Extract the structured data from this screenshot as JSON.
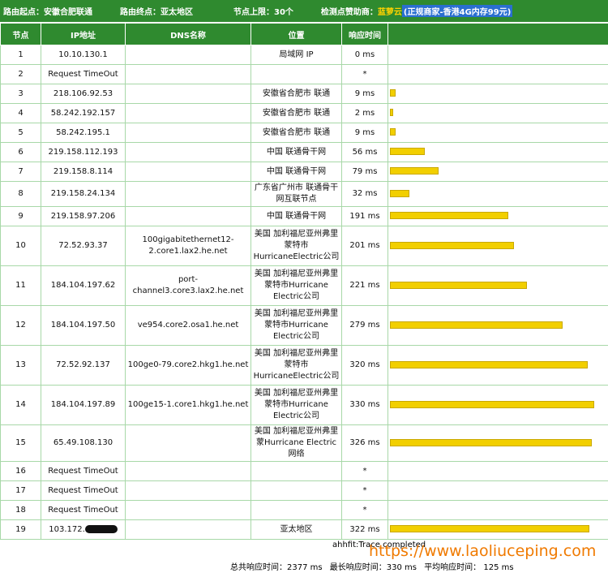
{
  "header": {
    "route_start": "路由起点：安徽合肥联通",
    "route_end": "路由终点：亚太地区",
    "node_limit": "节点上限：30个",
    "sponsor_label": "检测点赞助商：",
    "sponsor_name": "蓝萝云",
    "sponsor_note": "(正规商家-香港4G内存99元)"
  },
  "columns": [
    "节点",
    "IP地址",
    "DNS名称",
    "位置",
    "响应时间",
    ""
  ],
  "rows": [
    {
      "node": "1",
      "ip": "10.10.130.1",
      "dns": "",
      "loc": "局域网 IP",
      "time": "0 ms",
      "ms": 0
    },
    {
      "node": "2",
      "ip": "Request TimeOut",
      "dns": "",
      "loc": "",
      "time": "*",
      "ms": 0
    },
    {
      "node": "3",
      "ip": "218.106.92.53",
      "dns": "",
      "loc": "安徽省合肥市 联通",
      "time": "9 ms",
      "ms": 9
    },
    {
      "node": "4",
      "ip": "58.242.192.157",
      "dns": "",
      "loc": "安徽省合肥市 联通",
      "time": "2 ms",
      "ms": 2
    },
    {
      "node": "5",
      "ip": "58.242.195.1",
      "dns": "",
      "loc": "安徽省合肥市 联通",
      "time": "9 ms",
      "ms": 9
    },
    {
      "node": "6",
      "ip": "219.158.112.193",
      "dns": "",
      "loc": "中国 联通骨干网",
      "time": "56 ms",
      "ms": 56
    },
    {
      "node": "7",
      "ip": "219.158.8.114",
      "dns": "",
      "loc": "中国 联通骨干网",
      "time": "79 ms",
      "ms": 79
    },
    {
      "node": "8",
      "ip": "219.158.24.134",
      "dns": "",
      "loc": "广东省广州市 联通骨干网互联节点",
      "time": "32 ms",
      "ms": 32
    },
    {
      "node": "9",
      "ip": "219.158.97.206",
      "dns": "",
      "loc": "中国 联通骨干网",
      "time": "191 ms",
      "ms": 191
    },
    {
      "node": "10",
      "ip": "72.52.93.37",
      "dns": "100gigabitethernet12-2.core1.lax2.he.net",
      "loc": "美国 加利福尼亚州弗里蒙特市HurricaneElectric公司",
      "time": "201 ms",
      "ms": 201
    },
    {
      "node": "11",
      "ip": "184.104.197.62",
      "dns": "port-channel3.core3.lax2.he.net",
      "loc": "美国 加利福尼亚州弗里蒙特市Hurricane Electric公司",
      "time": "221 ms",
      "ms": 221
    },
    {
      "node": "12",
      "ip": "184.104.197.50",
      "dns": "ve954.core2.osa1.he.net",
      "loc": "美国 加利福尼亚州弗里蒙特市Hurricane Electric公司",
      "time": "279 ms",
      "ms": 279
    },
    {
      "node": "13",
      "ip": "72.52.92.137",
      "dns": "100ge0-79.core2.hkg1.he.net",
      "loc": "美国 加利福尼亚州弗里蒙特市HurricaneElectric公司",
      "time": "320 ms",
      "ms": 320
    },
    {
      "node": "14",
      "ip": "184.104.197.89",
      "dns": "100ge15-1.core1.hkg1.he.net",
      "loc": "美国 加利福尼亚州弗里蒙特市Hurricane Electric公司",
      "time": "330 ms",
      "ms": 330
    },
    {
      "node": "15",
      "ip": "65.49.108.130",
      "dns": "",
      "loc": "美国 加利福尼亚州弗里蒙Hurricane Electric网络",
      "time": "326 ms",
      "ms": 326
    },
    {
      "node": "16",
      "ip": "Request TimeOut",
      "dns": "",
      "loc": "",
      "time": "*",
      "ms": 0
    },
    {
      "node": "17",
      "ip": "Request TimeOut",
      "dns": "",
      "loc": "",
      "time": "*",
      "ms": 0
    },
    {
      "node": "18",
      "ip": "Request TimeOut",
      "dns": "",
      "loc": "",
      "time": "*",
      "ms": 0
    },
    {
      "node": "19",
      "ip": "103.172.",
      "dns": "",
      "loc": "亚太地区",
      "time": "322 ms",
      "ms": 322,
      "redacted": true
    }
  ],
  "bar_max_ms": 330,
  "footer": {
    "status": "ahhfit:Trace completed",
    "total": "总共响应时间：2377 ms",
    "max": "最长响应时间：330 ms",
    "avg": "平均响应时间： 125 ms"
  },
  "watermark": "https://www.laoliuceping.com",
  "colors": {
    "header_bg": "#2f8a2f",
    "bar": "#f2cf00",
    "border": "#a8d8a8",
    "watermark": "#f07a00"
  }
}
